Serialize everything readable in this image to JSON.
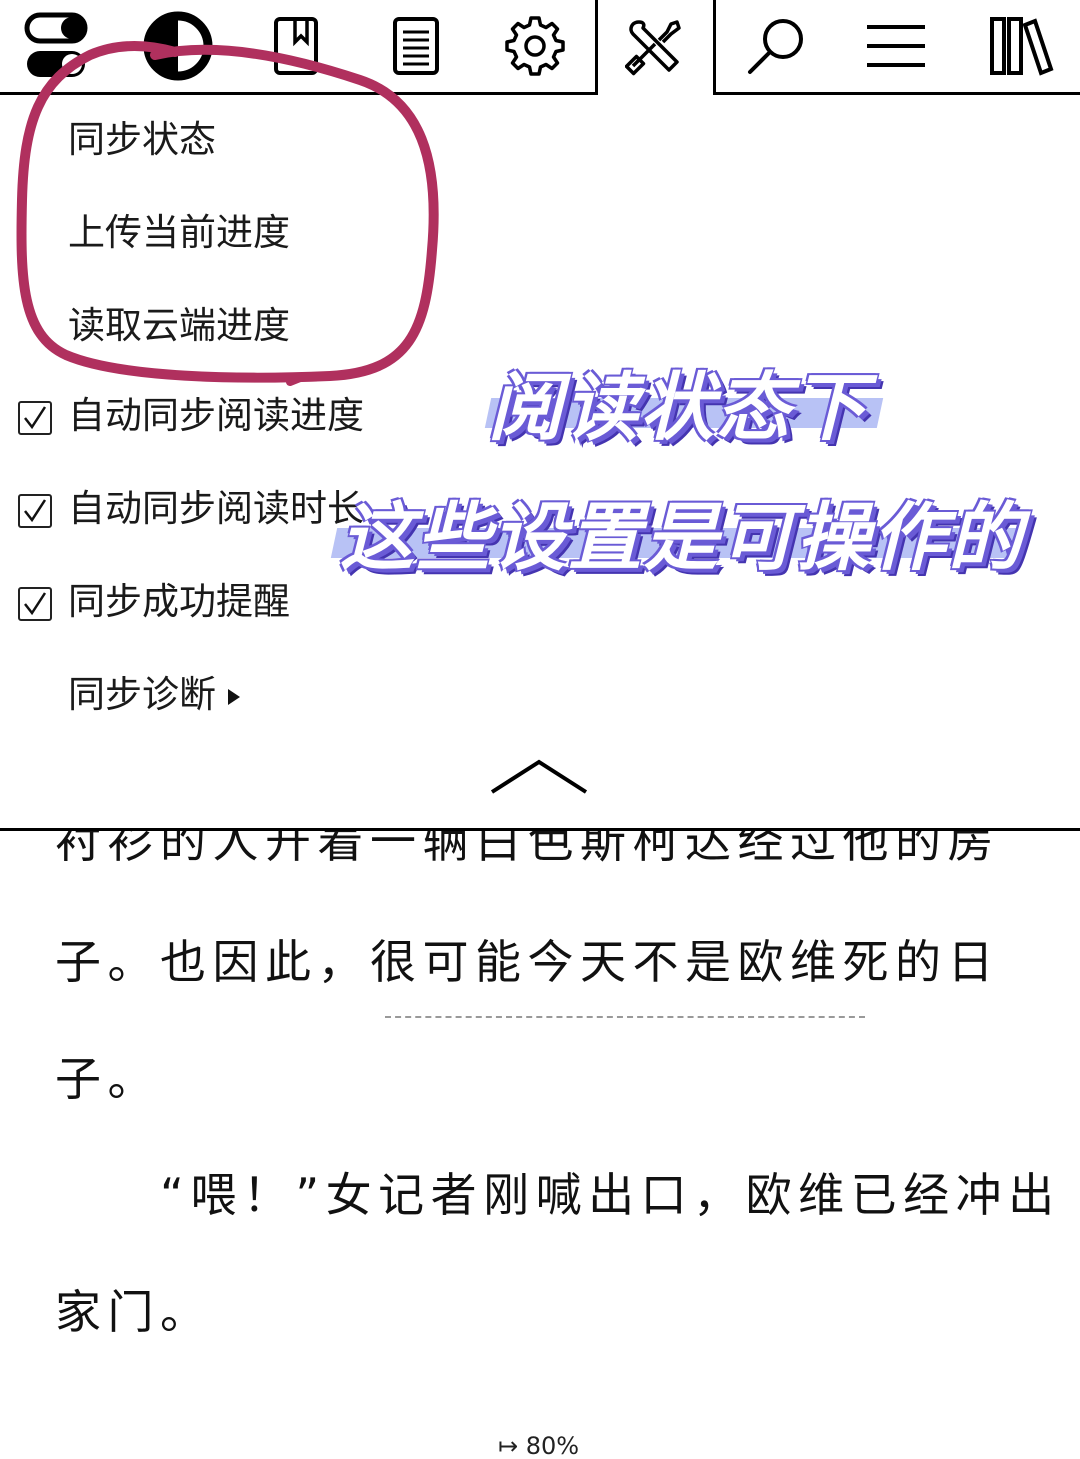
{
  "toolbar": {
    "icons": [
      "toggle-icon",
      "contrast-icon",
      "bookmark-icon",
      "toc-icon",
      "settings-gear-icon",
      "tools-icon",
      "search-icon",
      "menu-icon",
      "library-icon"
    ],
    "active_tab": "tools-icon"
  },
  "menu": {
    "items": [
      "同步状态",
      "上传当前进度",
      "读取云端进度"
    ],
    "checkbox_items": [
      {
        "label": "自动同步阅读进度",
        "checked": true
      },
      {
        "label": "自动同步阅读时长",
        "checked": true
      },
      {
        "label": "同步成功提醒",
        "checked": true
      }
    ],
    "submenu_label": "同步诊断"
  },
  "annotation": {
    "line1": "阅读状态下",
    "line2": "这些设置是可操作的",
    "circle_color": "#b0305e",
    "caption_color": "#6a5bd6"
  },
  "reader": {
    "line0": "衬衫的人开着一辆白色斯柯达经过他的房",
    "line1": "子。也因此，很可能今天不是欧维死的日",
    "line2": "子。",
    "line3": "　　“喂！”女记者刚喊出口，欧维已经冲出",
    "line4": "家门。",
    "progress_label": "80%",
    "progress_value": 0.8
  }
}
